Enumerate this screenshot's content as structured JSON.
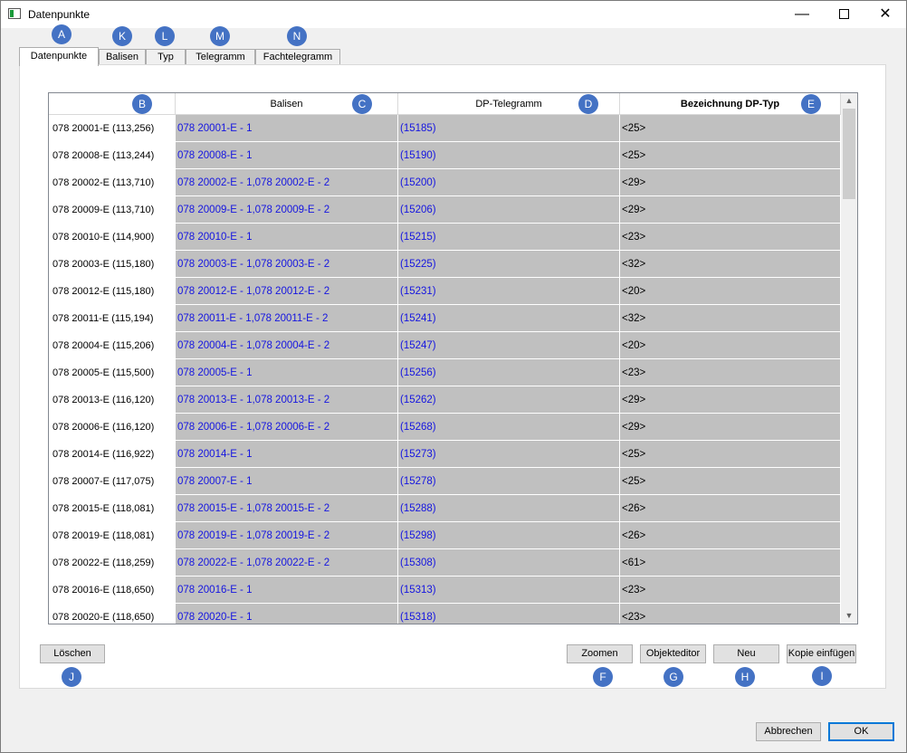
{
  "window": {
    "title": "Datenpunkte"
  },
  "tabs": [
    {
      "label": "Datenpunkte",
      "active": true
    },
    {
      "label": "Balisen"
    },
    {
      "label": "Typ"
    },
    {
      "label": "Telegramm"
    },
    {
      "label": "Fachtelegramm"
    }
  ],
  "grid": {
    "headers": [
      "Balisen",
      "DP-Telegramm",
      "Bezeichnung DP-Typ"
    ],
    "rows": [
      {
        "id": "078 20001-E (113,256)",
        "balisen": "078 20001-E - 1",
        "telegramm": "(15185)",
        "typ": "<25>"
      },
      {
        "id": "078 20008-E (113,244)",
        "balisen": "078 20008-E - 1",
        "telegramm": "(15190)",
        "typ": "<25>"
      },
      {
        "id": "078 20002-E (113,710)",
        "balisen": "078 20002-E - 1,078 20002-E - 2",
        "telegramm": "(15200)",
        "typ": "<29>"
      },
      {
        "id": "078 20009-E (113,710)",
        "balisen": "078 20009-E - 1,078 20009-E - 2",
        "telegramm": "(15206)",
        "typ": "<29>"
      },
      {
        "id": "078 20010-E (114,900)",
        "balisen": "078 20010-E - 1",
        "telegramm": "(15215)",
        "typ": "<23>"
      },
      {
        "id": "078 20003-E (115,180)",
        "balisen": "078 20003-E - 1,078 20003-E - 2",
        "telegramm": "(15225)",
        "typ": "<32>"
      },
      {
        "id": "078 20012-E (115,180)",
        "balisen": "078 20012-E - 1,078 20012-E - 2",
        "telegramm": "(15231)",
        "typ": "<20>"
      },
      {
        "id": "078 20011-E (115,194)",
        "balisen": "078 20011-E - 1,078 20011-E - 2",
        "telegramm": "(15241)",
        "typ": "<32>"
      },
      {
        "id": "078 20004-E (115,206)",
        "balisen": "078 20004-E - 1,078 20004-E - 2",
        "telegramm": "(15247)",
        "typ": "<20>"
      },
      {
        "id": "078 20005-E (115,500)",
        "balisen": "078 20005-E - 1",
        "telegramm": "(15256)",
        "typ": "<23>"
      },
      {
        "id": "078 20013-E (116,120)",
        "balisen": "078 20013-E - 1,078 20013-E - 2",
        "telegramm": "(15262)",
        "typ": "<29>"
      },
      {
        "id": "078 20006-E (116,120)",
        "balisen": "078 20006-E - 1,078 20006-E - 2",
        "telegramm": "(15268)",
        "typ": "<29>"
      },
      {
        "id": "078 20014-E (116,922)",
        "balisen": "078 20014-E - 1",
        "telegramm": "(15273)",
        "typ": "<25>"
      },
      {
        "id": "078 20007-E (117,075)",
        "balisen": "078 20007-E - 1",
        "telegramm": "(15278)",
        "typ": "<25>"
      },
      {
        "id": "078 20015-E (118,081)",
        "balisen": "078 20015-E - 1,078 20015-E - 2",
        "telegramm": "(15288)",
        "typ": "<26>"
      },
      {
        "id": "078 20019-E (118,081)",
        "balisen": "078 20019-E - 1,078 20019-E - 2",
        "telegramm": "(15298)",
        "typ": "<26>"
      },
      {
        "id": "078 20022-E (118,259)",
        "balisen": "078 20022-E - 1,078 20022-E - 2",
        "telegramm": "(15308)",
        "typ": "<61>"
      },
      {
        "id": "078 20016-E (118,650)",
        "balisen": "078 20016-E - 1",
        "telegramm": "(15313)",
        "typ": "<23>"
      },
      {
        "id": "078 20020-E (118,650)",
        "balisen": "078 20020-E - 1",
        "telegramm": "(15318)",
        "typ": "<23>"
      }
    ]
  },
  "buttons": {
    "loeschen": "Löschen",
    "zoomen": "Zoomen",
    "objekteditor": "Objekteditor",
    "neu": "Neu",
    "kopie": "Kopie einfügen",
    "abbrechen": "Abbrechen",
    "ok": "OK"
  },
  "badges": {
    "a": "A",
    "b": "B",
    "c": "C",
    "d": "D",
    "e": "E",
    "f": "F",
    "g": "G",
    "h": "H",
    "i": "I",
    "j": "J",
    "k": "K",
    "l": "L",
    "m": "M",
    "n": "N"
  },
  "icons": {
    "minimize": "minimize-icon",
    "maximize": "maximize-icon",
    "close": "close-icon",
    "scroll_up": "chevron-up-icon",
    "scroll_down": "chevron-down-icon"
  },
  "colors": {
    "link": "#1515e0",
    "cell_bg": "#c0c0c0",
    "badge": "#4472c4",
    "ok_border": "#0078d7"
  }
}
